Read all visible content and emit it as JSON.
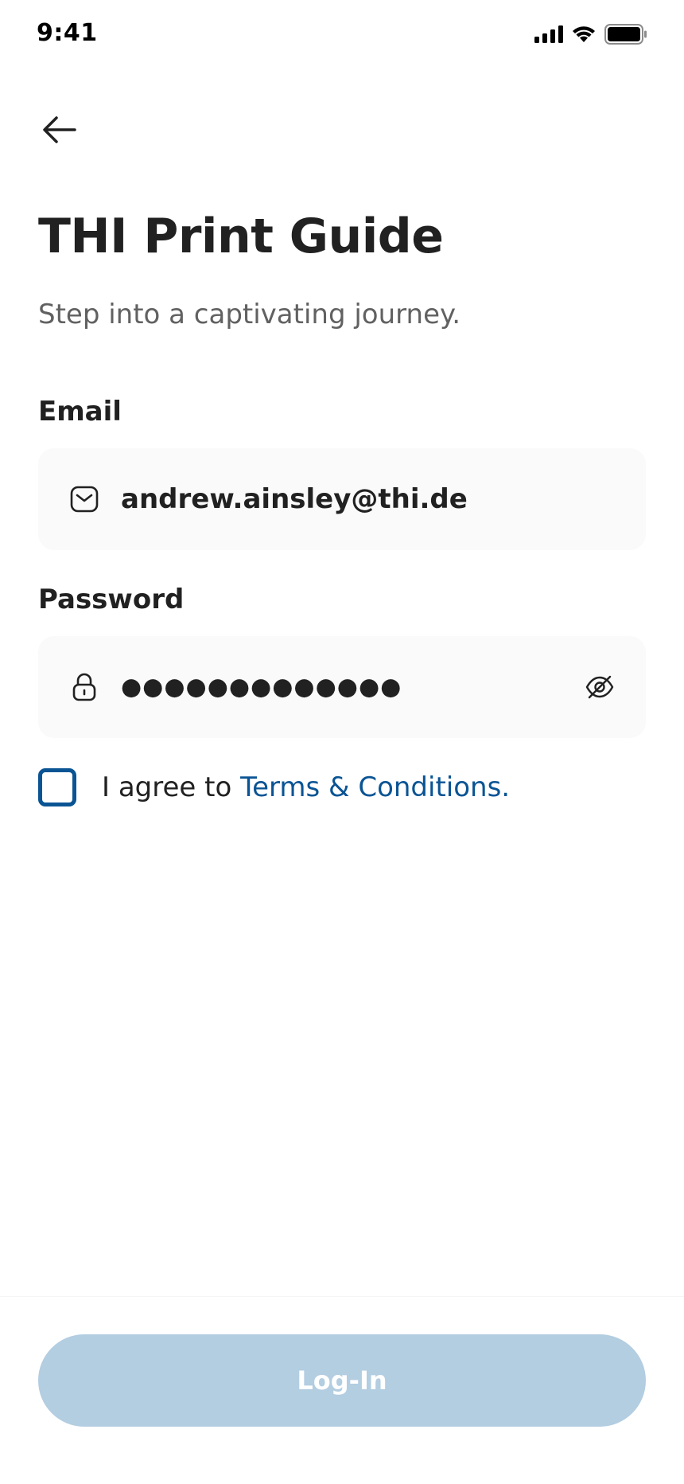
{
  "status_bar": {
    "time": "9:41",
    "icons": [
      "signal-icon",
      "wifi-icon",
      "battery-icon"
    ]
  },
  "header": {
    "back_icon": "arrow-left-icon",
    "title": "THI Print Guide",
    "subtitle": "Step into a captivating journey."
  },
  "form": {
    "email": {
      "label": "Email",
      "icon": "mail-icon",
      "value": "andrew.ainsley@thi.de"
    },
    "password": {
      "label": "Password",
      "icon": "lock-icon",
      "value": "●●●●●●●●●●●●●",
      "toggle_icon": "eye-off-icon"
    },
    "terms": {
      "checked": false,
      "prefix": "I agree to ",
      "link": "Terms & Conditions",
      "suffix": "."
    }
  },
  "actions": {
    "login_label": "Log-In"
  },
  "colors": {
    "accent": "#0a5494",
    "button_disabled": "#b3cde1",
    "input_bg": "#fafafa",
    "text_primary": "#212121",
    "text_secondary": "#616161"
  }
}
